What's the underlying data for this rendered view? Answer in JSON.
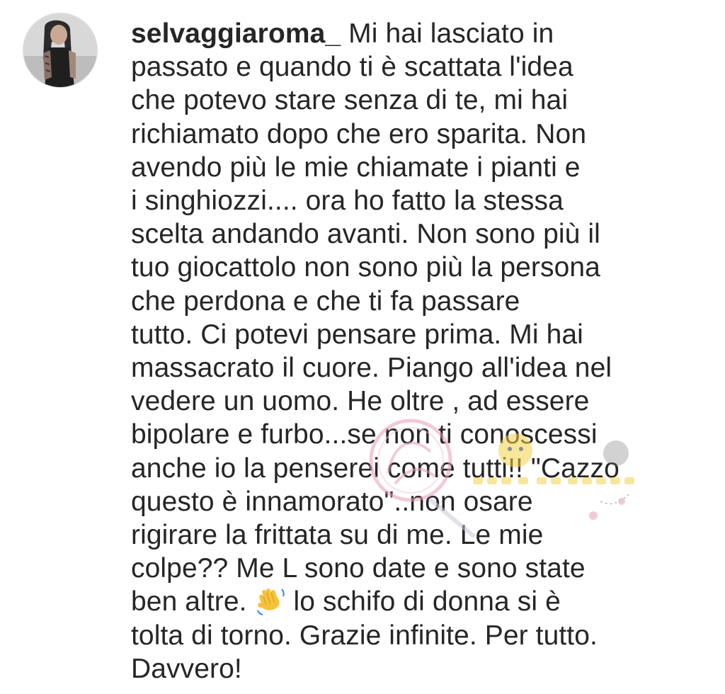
{
  "comment": {
    "username": "selvaggiaroma_",
    "lines": [
      " Mi hai lasciato in",
      "passato e quando ti è scattata l'idea",
      "che potevo stare senza di te, mi hai",
      "richiamato dopo che ero sparita. Non",
      "avendo più le mie chiamate i pianti e",
      "i singhiozzi.... ora ho fatto la stessa",
      "scelta andando avanti. Non sono più il",
      "tuo giocattolo non sono più la persona",
      "che perdona e che ti fa passare",
      "tutto. Ci potevi pensare prima. Mi hai",
      "massacrato il cuore. Piango all'idea nel",
      "vedere un uomo. He oltre , ad essere",
      "bipolare e furbo...se non ti conoscessi",
      "anche io la penserei come tutti!! \"Cazzo",
      "questo è innamorato\"..non osare",
      "rigirare la frittata su di me. Le mie",
      "colpe?? Me L sono date e sono state"
    ],
    "line_before_emoji": "ben altre. ",
    "line_after_emoji": " lo schifo di donna si è",
    "final_lines": [
      "tolta di torno. Grazie infinite. Per tutto.",
      "Davvero!"
    ],
    "emoji_icon": "waving-hand-icon"
  },
  "avatar": {
    "icon": "profile-photo"
  },
  "colors": {
    "text": "#262626",
    "background": "#ffffff",
    "watermark_pink": "#e6a0b4",
    "watermark_yellow": "#f3d24a"
  }
}
